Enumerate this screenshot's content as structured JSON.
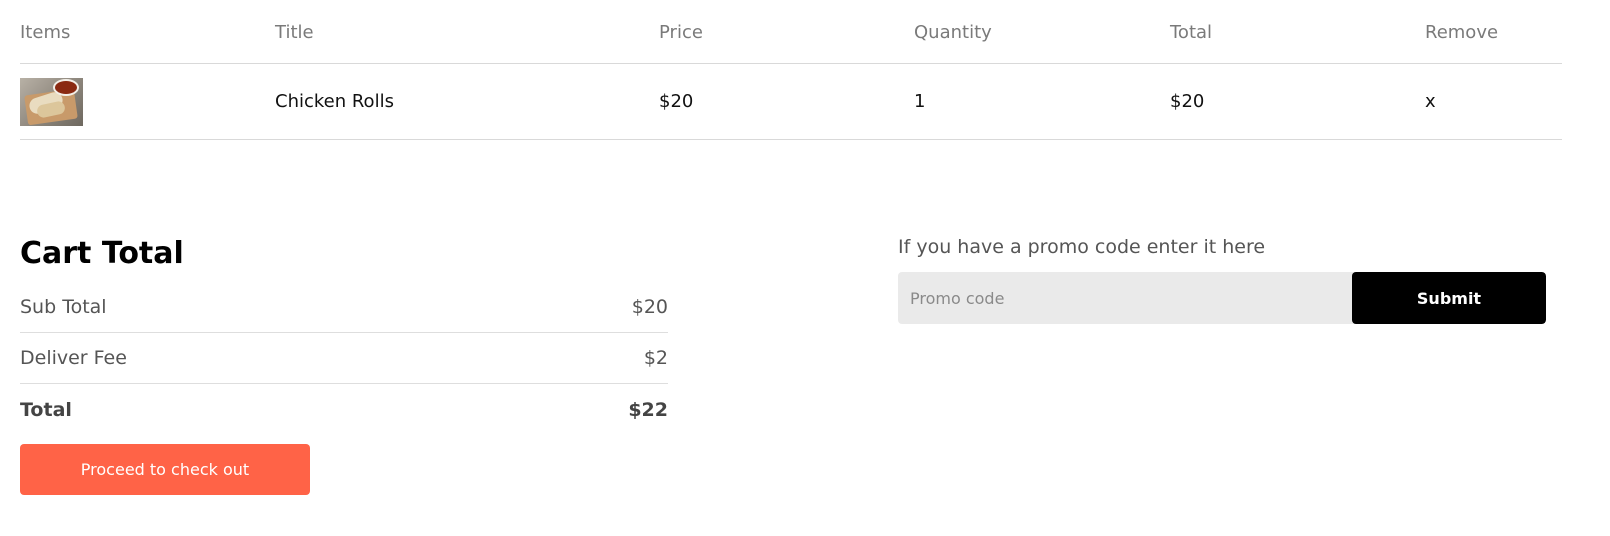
{
  "cart": {
    "headers": [
      "Items",
      "Title",
      "Price",
      "Quantity",
      "Total",
      "Remove"
    ],
    "items": [
      {
        "image": "chicken-rolls-photo",
        "title": "Chicken Rolls",
        "price": "$20",
        "quantity": "1",
        "total": "$20",
        "remove": "x"
      }
    ]
  },
  "totals": {
    "heading": "Cart Total",
    "subtotal_label": "Sub Total",
    "subtotal_value": "$20",
    "fee_label": "Deliver Fee",
    "fee_value": "$2",
    "total_label": "Total",
    "total_value": "$22",
    "checkout_label": "Proceed to check out"
  },
  "promo": {
    "label": "If you have a promo code enter it here",
    "placeholder": "Promo code",
    "submit_label": "Submit"
  },
  "colors": {
    "accent": "#ff6347",
    "submit_bg": "#000000",
    "input_bg": "#eaeaea"
  }
}
